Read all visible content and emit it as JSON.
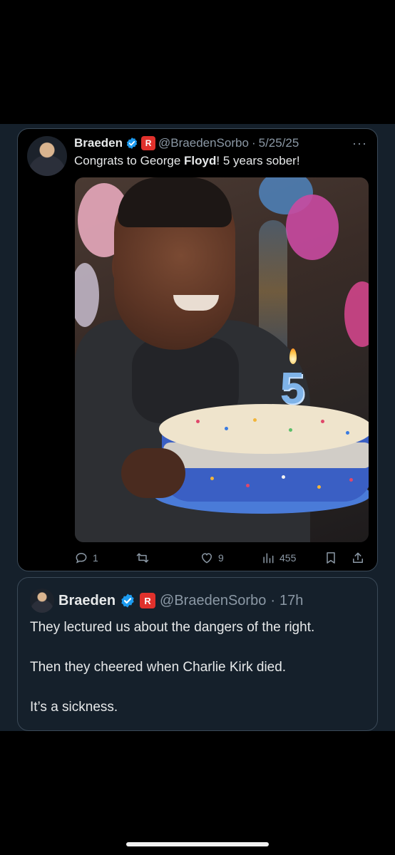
{
  "tweet": {
    "name": "Braeden",
    "affiliate_badge": "R",
    "handle": "@BraedenSorbo",
    "separator": "·",
    "date": "5/25/25",
    "more": "···",
    "text_before": "Congrats to George ",
    "text_bold": "Floyd",
    "text_after": "! 5 years sober!",
    "candle_number": "5",
    "actions": {
      "replies": "1",
      "reposts": "",
      "likes": "9",
      "views": "455"
    }
  },
  "quote": {
    "name": "Braeden",
    "affiliate_badge": "R",
    "handle": "@BraedenSorbo",
    "separator": "·",
    "time": "17h",
    "line1": "They lectured us about the dangers of the right.",
    "line2": "Then they cheered when Charlie Kirk died.",
    "line3": "It’s a sickness."
  },
  "icons": {
    "verified": "verified-icon",
    "reply": "reply-icon",
    "repost": "repost-icon",
    "like": "heart-icon",
    "views": "views-icon",
    "bookmark": "bookmark-icon",
    "share": "share-icon"
  },
  "colors": {
    "background_dark": "#15202b",
    "verified_blue": "#1d9bf0",
    "muted_text": "#8b98a5",
    "affiliate_red": "#e0312c"
  }
}
